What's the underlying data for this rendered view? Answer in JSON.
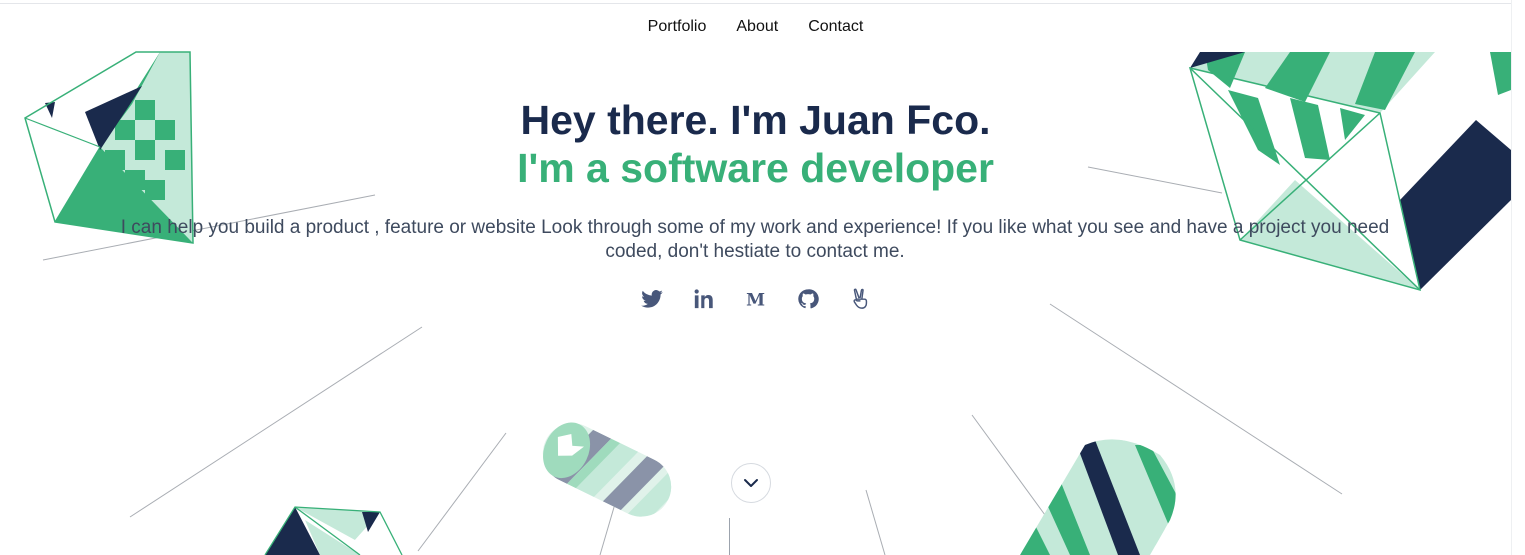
{
  "nav": {
    "items": [
      {
        "label": "Portfolio"
      },
      {
        "label": "About"
      },
      {
        "label": "Contact"
      }
    ]
  },
  "hero": {
    "title": "Hey there. I'm Juan Fco.",
    "subtitle": "I'm a software developer",
    "description": "I can help you build a product , feature or website Look through some of my work and experience! If you like what you see and have a project you need coded, don't hestiate to contact me."
  },
  "social": {
    "icons": [
      "twitter-icon",
      "linkedin-icon",
      "medium-icon",
      "github-icon",
      "angellist-icon"
    ]
  },
  "scroll": {
    "icon": "chevron-down-icon"
  },
  "colors": {
    "navy": "#1a2a4c",
    "green": "#38b078",
    "light_green": "#c4e9d9",
    "slate": "#8a93a8",
    "text": "#3e4a5e"
  }
}
